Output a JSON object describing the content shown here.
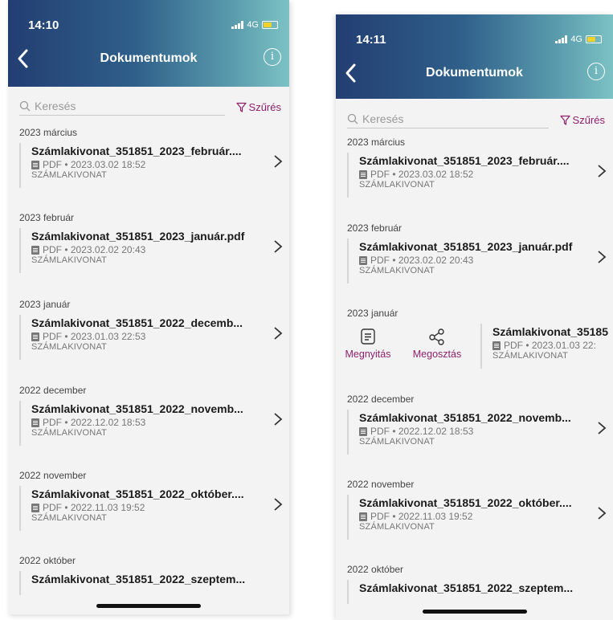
{
  "left": {
    "time": "14:10",
    "network": "4G",
    "title": "Dokumentumok",
    "search_placeholder": "Keresés",
    "filter_label": "Szűrés",
    "sections": [
      {
        "label": "2023 március",
        "title": "Számlakivonat_351851_2023_február....",
        "meta": "PDF • 2023.03.02 18:52",
        "category": "SZÁMLAKIVONAT"
      },
      {
        "label": "2023 február",
        "title": "Számlakivonat_351851_2023_január.pdf",
        "meta": "PDF • 2023.02.02 20:43",
        "category": "SZÁMLAKIVONAT"
      },
      {
        "label": "2023 január",
        "title": "Számlakivonat_351851_2022_decemb...",
        "meta": "PDF • 2023.01.03 22:53",
        "category": "SZÁMLAKIVONAT"
      },
      {
        "label": "2022 december",
        "title": "Számlakivonat_351851_2022_novemb...",
        "meta": "PDF • 2022.12.02 18:53",
        "category": "SZÁMLAKIVONAT"
      },
      {
        "label": "2022 november",
        "title": "Számlakivonat_351851_2022_október....",
        "meta": "PDF • 2022.11.03 19:52",
        "category": "SZÁMLAKIVONAT"
      },
      {
        "label": "2022 október",
        "title": "Számlakivonat_351851_2022_szeptem...",
        "meta": "",
        "category": ""
      }
    ]
  },
  "right": {
    "time": "14:11",
    "network": "4G",
    "title": "Dokumentumok",
    "search_placeholder": "Keresés",
    "filter_label": "Szűrés",
    "swipe_actions": {
      "open_label": "Megnyitás",
      "share_label": "Megosztás"
    },
    "sections": [
      {
        "label": "2023 március",
        "title": "Számlakivonat_351851_2023_február....",
        "meta": "PDF • 2023.03.02 18:52",
        "category": "SZÁMLAKIVONAT"
      },
      {
        "label": "2023 február",
        "title": "Számlakivonat_351851_2023_január.pdf",
        "meta": "PDF • 2023.02.02 20:43",
        "category": "SZÁMLAKIVONAT"
      },
      {
        "label": "2023 január",
        "title": "Számlakivonat_35185",
        "meta": "PDF • 2023.01.03 22:",
        "category": "SZÁMLAKIVONAT"
      },
      {
        "label": "2022 december",
        "title": "Számlakivonat_351851_2022_novemb...",
        "meta": "PDF • 2022.12.02 18:53",
        "category": "SZÁMLAKIVONAT"
      },
      {
        "label": "2022 november",
        "title": "Számlakivonat_351851_2022_október....",
        "meta": "PDF • 2022.11.03 19:52",
        "category": "SZÁMLAKIVONAT"
      },
      {
        "label": "2022 október",
        "title": "Számlakivonat_351851_2022_szeptem...",
        "meta": "",
        "category": ""
      }
    ]
  },
  "colors": {
    "accent": "#8e1f6b",
    "header_start": "#233e72",
    "header_end": "#7cc2c4"
  }
}
